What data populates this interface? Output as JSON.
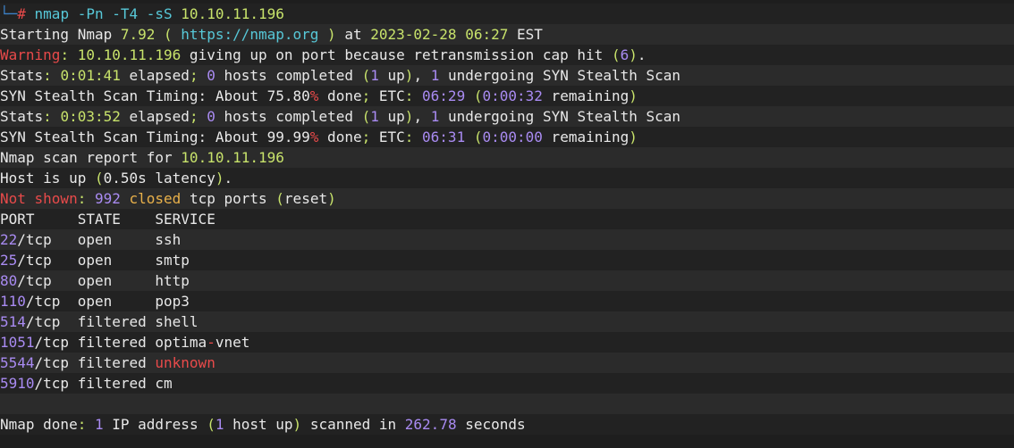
{
  "colors": {
    "default": "#e8e8e8",
    "number": "#a98bf2",
    "string": "#c8e36b",
    "url": "#57c8d8",
    "warning": "#e84a4a",
    "closed": "#e8b04a",
    "prompt": "#3c82c8"
  },
  "lines": [
    [
      {
        "t": "└─",
        "c": "prompt"
      },
      {
        "t": "#",
        "c": "warning"
      },
      {
        "t": " nmap -Pn -T4 -sS ",
        "c": "url"
      },
      {
        "t": "10.10.11.196",
        "c": "string"
      }
    ],
    [
      {
        "t": "Starting Nmap ",
        "c": "default"
      },
      {
        "t": "7.92",
        "c": "string"
      },
      {
        "t": " ( ",
        "c": "string"
      },
      {
        "t": "https://nmap.org",
        "c": "url"
      },
      {
        "t": " ) ",
        "c": "string"
      },
      {
        "t": "at ",
        "c": "default"
      },
      {
        "t": "2023-02-28 06:27",
        "c": "string"
      },
      {
        "t": " EST",
        "c": "default"
      }
    ],
    [
      {
        "t": "Warning",
        "c": "warning"
      },
      {
        "t": ": ",
        "c": "string"
      },
      {
        "t": "10.10.11.196",
        "c": "string"
      },
      {
        "t": " giving up on port because retransmission cap hit ",
        "c": "default"
      },
      {
        "t": "(",
        "c": "string"
      },
      {
        "t": "6",
        "c": "number"
      },
      {
        "t": ")",
        "c": "string"
      },
      {
        "t": ".",
        "c": "default"
      }
    ],
    [
      {
        "t": "Stats",
        "c": "default"
      },
      {
        "t": ": ",
        "c": "string"
      },
      {
        "t": "0:01:41",
        "c": "string"
      },
      {
        "t": " elapsed",
        "c": "default"
      },
      {
        "t": "; ",
        "c": "string"
      },
      {
        "t": "0",
        "c": "number"
      },
      {
        "t": " hosts completed ",
        "c": "default"
      },
      {
        "t": "(",
        "c": "string"
      },
      {
        "t": "1",
        "c": "number"
      },
      {
        "t": " up",
        "c": "default"
      },
      {
        "t": ")",
        "c": "string"
      },
      {
        "t": ", ",
        "c": "default"
      },
      {
        "t": "1",
        "c": "number"
      },
      {
        "t": " undergoing SYN Stealth Scan",
        "c": "default"
      }
    ],
    [
      {
        "t": "SYN Stealth Scan Timing: About 75.80",
        "c": "default"
      },
      {
        "t": "%",
        "c": "warning"
      },
      {
        "t": " done",
        "c": "default"
      },
      {
        "t": "; ",
        "c": "string"
      },
      {
        "t": "ETC",
        "c": "default"
      },
      {
        "t": ": ",
        "c": "string"
      },
      {
        "t": "06:29",
        "c": "number"
      },
      {
        "t": " ",
        "c": "default"
      },
      {
        "t": "(",
        "c": "string"
      },
      {
        "t": "0:00:32",
        "c": "number"
      },
      {
        "t": " remaining",
        "c": "default"
      },
      {
        "t": ")",
        "c": "string"
      }
    ],
    [
      {
        "t": "Stats",
        "c": "default"
      },
      {
        "t": ": ",
        "c": "string"
      },
      {
        "t": "0:03:52",
        "c": "string"
      },
      {
        "t": " elapsed",
        "c": "default"
      },
      {
        "t": "; ",
        "c": "string"
      },
      {
        "t": "0",
        "c": "number"
      },
      {
        "t": " hosts completed ",
        "c": "default"
      },
      {
        "t": "(",
        "c": "string"
      },
      {
        "t": "1",
        "c": "number"
      },
      {
        "t": " up",
        "c": "default"
      },
      {
        "t": ")",
        "c": "string"
      },
      {
        "t": ", ",
        "c": "default"
      },
      {
        "t": "1",
        "c": "number"
      },
      {
        "t": " undergoing SYN Stealth Scan",
        "c": "default"
      }
    ],
    [
      {
        "t": "SYN Stealth Scan Timing: About 99.99",
        "c": "default"
      },
      {
        "t": "%",
        "c": "warning"
      },
      {
        "t": " done",
        "c": "default"
      },
      {
        "t": "; ",
        "c": "string"
      },
      {
        "t": "ETC",
        "c": "default"
      },
      {
        "t": ": ",
        "c": "string"
      },
      {
        "t": "06:31",
        "c": "number"
      },
      {
        "t": " ",
        "c": "default"
      },
      {
        "t": "(",
        "c": "string"
      },
      {
        "t": "0:00:00",
        "c": "number"
      },
      {
        "t": " remaining",
        "c": "default"
      },
      {
        "t": ")",
        "c": "string"
      }
    ],
    [
      {
        "t": "Nmap scan report for ",
        "c": "default"
      },
      {
        "t": "10.10.11.196",
        "c": "string"
      }
    ],
    [
      {
        "t": "Host is up ",
        "c": "default"
      },
      {
        "t": "(",
        "c": "string"
      },
      {
        "t": "0.50s latency",
        "c": "default"
      },
      {
        "t": ")",
        "c": "string"
      },
      {
        "t": ".",
        "c": "default"
      }
    ],
    [
      {
        "t": "Not shown",
        "c": "warning"
      },
      {
        "t": ": ",
        "c": "string"
      },
      {
        "t": "992",
        "c": "number"
      },
      {
        "t": " ",
        "c": "default"
      },
      {
        "t": "closed",
        "c": "closed"
      },
      {
        "t": " tcp ports ",
        "c": "default"
      },
      {
        "t": "(",
        "c": "string"
      },
      {
        "t": "reset",
        "c": "default"
      },
      {
        "t": ")",
        "c": "string"
      }
    ],
    [
      {
        "t": "PORT     STATE    SERVICE",
        "c": "default"
      }
    ],
    [
      {
        "t": "22",
        "c": "number"
      },
      {
        "t": "/tcp   open     ssh",
        "c": "default"
      }
    ],
    [
      {
        "t": "25",
        "c": "number"
      },
      {
        "t": "/tcp   open     smtp",
        "c": "default"
      }
    ],
    [
      {
        "t": "80",
        "c": "number"
      },
      {
        "t": "/tcp   open     http",
        "c": "default"
      }
    ],
    [
      {
        "t": "110",
        "c": "number"
      },
      {
        "t": "/tcp  open     pop3",
        "c": "default"
      }
    ],
    [
      {
        "t": "514",
        "c": "number"
      },
      {
        "t": "/tcp  filtered shell",
        "c": "default"
      }
    ],
    [
      {
        "t": "1051",
        "c": "number"
      },
      {
        "t": "/tcp filtered optima",
        "c": "default"
      },
      {
        "t": "-",
        "c": "warning"
      },
      {
        "t": "vnet",
        "c": "default"
      }
    ],
    [
      {
        "t": "5544",
        "c": "number"
      },
      {
        "t": "/tcp filtered ",
        "c": "default"
      },
      {
        "t": "unknown",
        "c": "warning"
      }
    ],
    [
      {
        "t": "5910",
        "c": "number"
      },
      {
        "t": "/tcp filtered cm",
        "c": "default"
      }
    ],
    [],
    [
      {
        "t": "Nmap done",
        "c": "default"
      },
      {
        "t": ": ",
        "c": "string"
      },
      {
        "t": "1",
        "c": "number"
      },
      {
        "t": " IP address ",
        "c": "default"
      },
      {
        "t": "(",
        "c": "string"
      },
      {
        "t": "1",
        "c": "number"
      },
      {
        "t": " host up",
        "c": "default"
      },
      {
        "t": ")",
        "c": "string"
      },
      {
        "t": " scanned in ",
        "c": "default"
      },
      {
        "t": "262.78",
        "c": "number"
      },
      {
        "t": " seconds",
        "c": "default"
      }
    ]
  ]
}
